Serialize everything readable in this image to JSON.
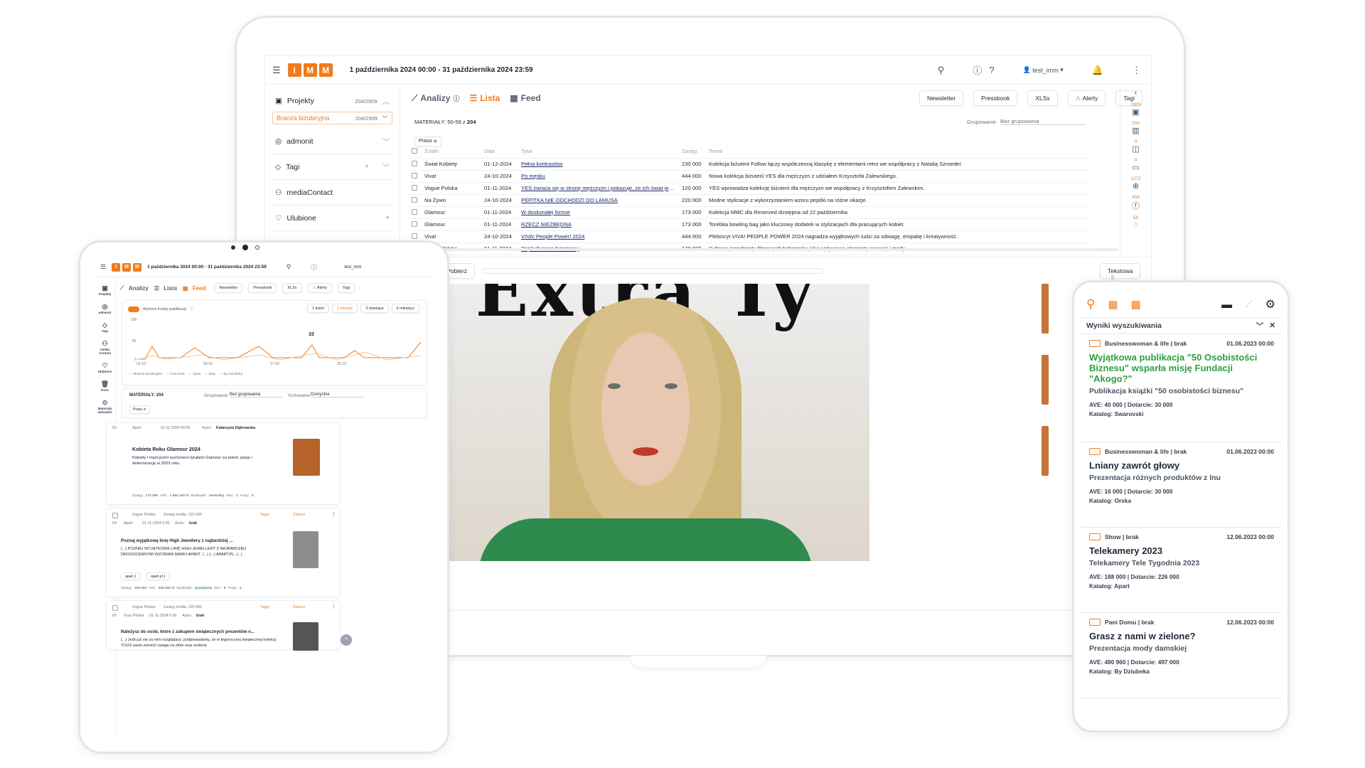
{
  "brand": {
    "logo_letters": [
      "I",
      "M",
      "M"
    ],
    "accent": "#f07c1e"
  },
  "laptop": {
    "date_range": "1 października 2024 00:00 - 31 października 2024 23:59",
    "user": "test_imm",
    "nav": {
      "projects_label": "Projekty",
      "projects_count": "204/2909",
      "sub_label": "Branża biżuteryjna",
      "sub_count": "204/2909",
      "items": [
        "admonit",
        "Tagi",
        "mediaContact",
        "Ulubione"
      ]
    },
    "tabs": [
      "Analizy",
      "Lista",
      "Feed"
    ],
    "buttons": [
      "Newsletter",
      "Pressbook",
      "XLSx",
      "Alerty",
      "Tagi"
    ],
    "materials_label": "MATERIAŁY:",
    "materials_range": "50-59 z",
    "materials_total": "204",
    "grouping_label": "Grupowanie",
    "grouping_value": "Bez grupowania",
    "filter_chip": "Prasa",
    "table": {
      "headers": [
        "Źródło",
        "Data",
        "Tytuł",
        "Zasięg",
        "Temat"
      ],
      "rows": [
        [
          "Świat Kobiety",
          "01-12-2024",
          "Pełna kontrastów",
          "230 000",
          "Kolekcja biżuterii Follow łączy współczesną klasykę z elementami retro we współpracy z Natalią Szroeder."
        ],
        [
          "Viva!",
          "24-10-2024",
          "Po męsku",
          "444 000",
          "Nowa kolekcja biżuterii YES dla mężczyzn z udziałem Krzysztofa Zalewskiego."
        ],
        [
          "Vogue Polska",
          "01-11-2024",
          "YES zwraca się w stronę mężczyzn i pokazuje, że ich świat jest ...",
          "120 000",
          "YES wprowadza kolekcję biżuterii dla mężczyzn we współpracy z Krzysztofem Zalewskim."
        ],
        [
          "Na Żywo",
          "24-10-2024",
          "PEPITKA NIE ODCHODZI DO LAMUSA",
          "220 000",
          "Modne stylizacje z wykorzystaniem wzoru pepitki na różne okazje."
        ],
        [
          "Glamour",
          "01-11-2024",
          "W doskonałej formie",
          "173 000",
          "Kolekcja MMC dla Reserved dostępna od 22 października."
        ],
        [
          "Glamour",
          "01-11-2024",
          "RZECZ NIEZBĘDNA",
          "173 000",
          "Torebka bowling bag jako kluczowy dodatek w stylizacjach dla pracujących kobiet."
        ],
        [
          "Viva!",
          "24-10-2024",
          "VIVA! People Power! 2024",
          "444 000",
          "Plebiscyt VIVA! PEOPLE POWER 2024 nagradza wyjątkowych ludzi za odwagę, empatię i kreatywność."
        ],
        [
          "Vogue Polska",
          "01-11-2024",
          "Popkulturowe fenomeny",
          "120 000",
          "Kultowe przedmioty filmowych bohaterów jako wpływowe elementy narracji i mody."
        ]
      ]
    },
    "rail_counts": [
      "2909",
      "204",
      "0",
      "0",
      "1372",
      "454",
      "58"
    ],
    "viewer": {
      "download": "Pobierz",
      "mode": "Tekstowa",
      "headline": "Extra Ty"
    }
  },
  "tablet": {
    "date_range": "1 października 2024 00:00 - 31 października 2024 23:59",
    "user": "test_imm",
    "side": [
      "Projekty",
      "admonit",
      "Tagi",
      "media Contact",
      "Ulubione",
      "Kosz",
      "Materiały specjalne"
    ],
    "tabs": [
      "Analizy",
      "Lista",
      "Feed"
    ],
    "buttons": [
      "Newsletter",
      "Pressbook",
      "XLSx",
      "Alerty",
      "Tagi"
    ],
    "chart_toggle": "Wykres liczby publikacji",
    "periods": [
      "1 dzień",
      "1 miesiąc",
      "3 miesiące",
      "6 miesięcy"
    ],
    "y_ticks": [
      "100",
      "50",
      "0"
    ],
    "x_ticks": [
      "01-10",
      "09-10",
      "17-10",
      "25-10"
    ],
    "peak": "33",
    "legend": [
      "Branża biżuteryjna",
      "Ania Kruk",
      "Apart",
      "Briju",
      "By Dziubeka"
    ],
    "materials": "MATERIAŁY: 204",
    "grouping_label": "Grupowanie",
    "grouping_value": "Bez grupowania",
    "sort_label": "Sortowanie",
    "sort_value": "Domyślne",
    "chip": "Prasa",
    "cards": [
      {
        "num": "63",
        "source": "Apart",
        "date": "01-11-2024 00:00",
        "author_label": "Autor:",
        "author": "Katarzyna Dąbrowska",
        "title": "Kobieta Roku Glamour 2024",
        "body": "Kobiety i mężczyźni wyróżnieni tytułami Glamour za talent, pasję i determinację w 2023 roku.",
        "meta": [
          "Zasięg:",
          "173 000",
          "AVE:",
          "1 664 100 zł",
          "Wydźwięk:",
          "neutralny",
          "Moc:",
          "2",
          "Frazy:",
          "0"
        ]
      },
      {
        "num": "64",
        "source": "Vogue Polska",
        "reach": "Zasięg źródła: 120 000",
        "source2": "Apart",
        "date": "01-11-2024 0:00",
        "author_label": "Autor:",
        "author": "brak",
        "tag": "Taguj",
        "see": "Zobacz",
        "title": "Poznaj wyjątkową linię High Jewellery z najbardziej ...",
        "body": "(...) POZNAJ WYJĄTKOWĄ LINIĘ HIGH JEWELLERY Z NAJBARDZIEJ DROGOCENNYMI WZORAMI MARKI APART. (...) (...) APART.PL. (...)",
        "chips": [
          "apart 1",
          "apart.pl 1"
        ],
        "meta": [
          "Zasięg:",
          "120 000",
          "AVE:",
          "204 240 zł",
          "Wydźwięk:",
          "pozytywny",
          "Moc:",
          "5",
          "Frazy:",
          "2"
        ]
      },
      {
        "num": "65",
        "source": "Vogue Polska",
        "reach": "Zasięg źródła: 120 000",
        "source2": "Tous Polska",
        "date": "01-11-2024 0:00",
        "author_label": "Autor:",
        "author": "brak",
        "tag": "Taguj",
        "see": "Zobacz",
        "title": "Należysz do osób, które z zakupem świątecznych prezentów n...",
        "body": "(...) Jeśli już się za nimi rozglądasz, podpowiadamy, że w tegorocznej świątecznej kolekcji TOUS warto zwrócić uwagę na złote oraz srebrne"
      }
    ]
  },
  "phone": {
    "header": "Wyniki wyszukiwania",
    "results": [
      {
        "source": "Businesswoman & life | brak",
        "date": "01.06.2023 00:00",
        "title": "Wyjątkowa publikacja \"50 Osobistości Biznesu\" wsparła misję Fundacji \"Akogo?\"",
        "subtitle": "Publikacja książki \"50 osobistości biznesu\"",
        "ave": "AVE: 40 000 | Dotarcie: 30 000",
        "catalog": "Katalog: Swarovski",
        "highlight": true
      },
      {
        "source": "Businesswoman & life | brak",
        "date": "01.06.2023 00:00",
        "title": "Lniany zawrót głowy",
        "subtitle": "Prezentacja różnych produktów z lnu",
        "ave": "AVE: 16 000 | Dotarcie: 30 000",
        "catalog": "Katalog: Orska",
        "highlight": false
      },
      {
        "source": "Show | brak",
        "date": "12.06.2023 00:00",
        "title": "Telekamery 2023",
        "subtitle": "Telekamery Tele Tygodnia 2023",
        "ave": "AVE: 188 000 | Dotarcie: 226 000",
        "catalog": "Katalog: Apart",
        "highlight": false
      },
      {
        "source": "Pani Domu | brak",
        "date": "12.06.2023 00:00",
        "title": "Grasz z nami w zielone?",
        "subtitle": "Prezentacja mody damskiej",
        "ave": "AVE: 480 960 | Dotarcie: 497 000",
        "catalog": "Katalog: By Dziubeka",
        "highlight": false
      }
    ]
  }
}
